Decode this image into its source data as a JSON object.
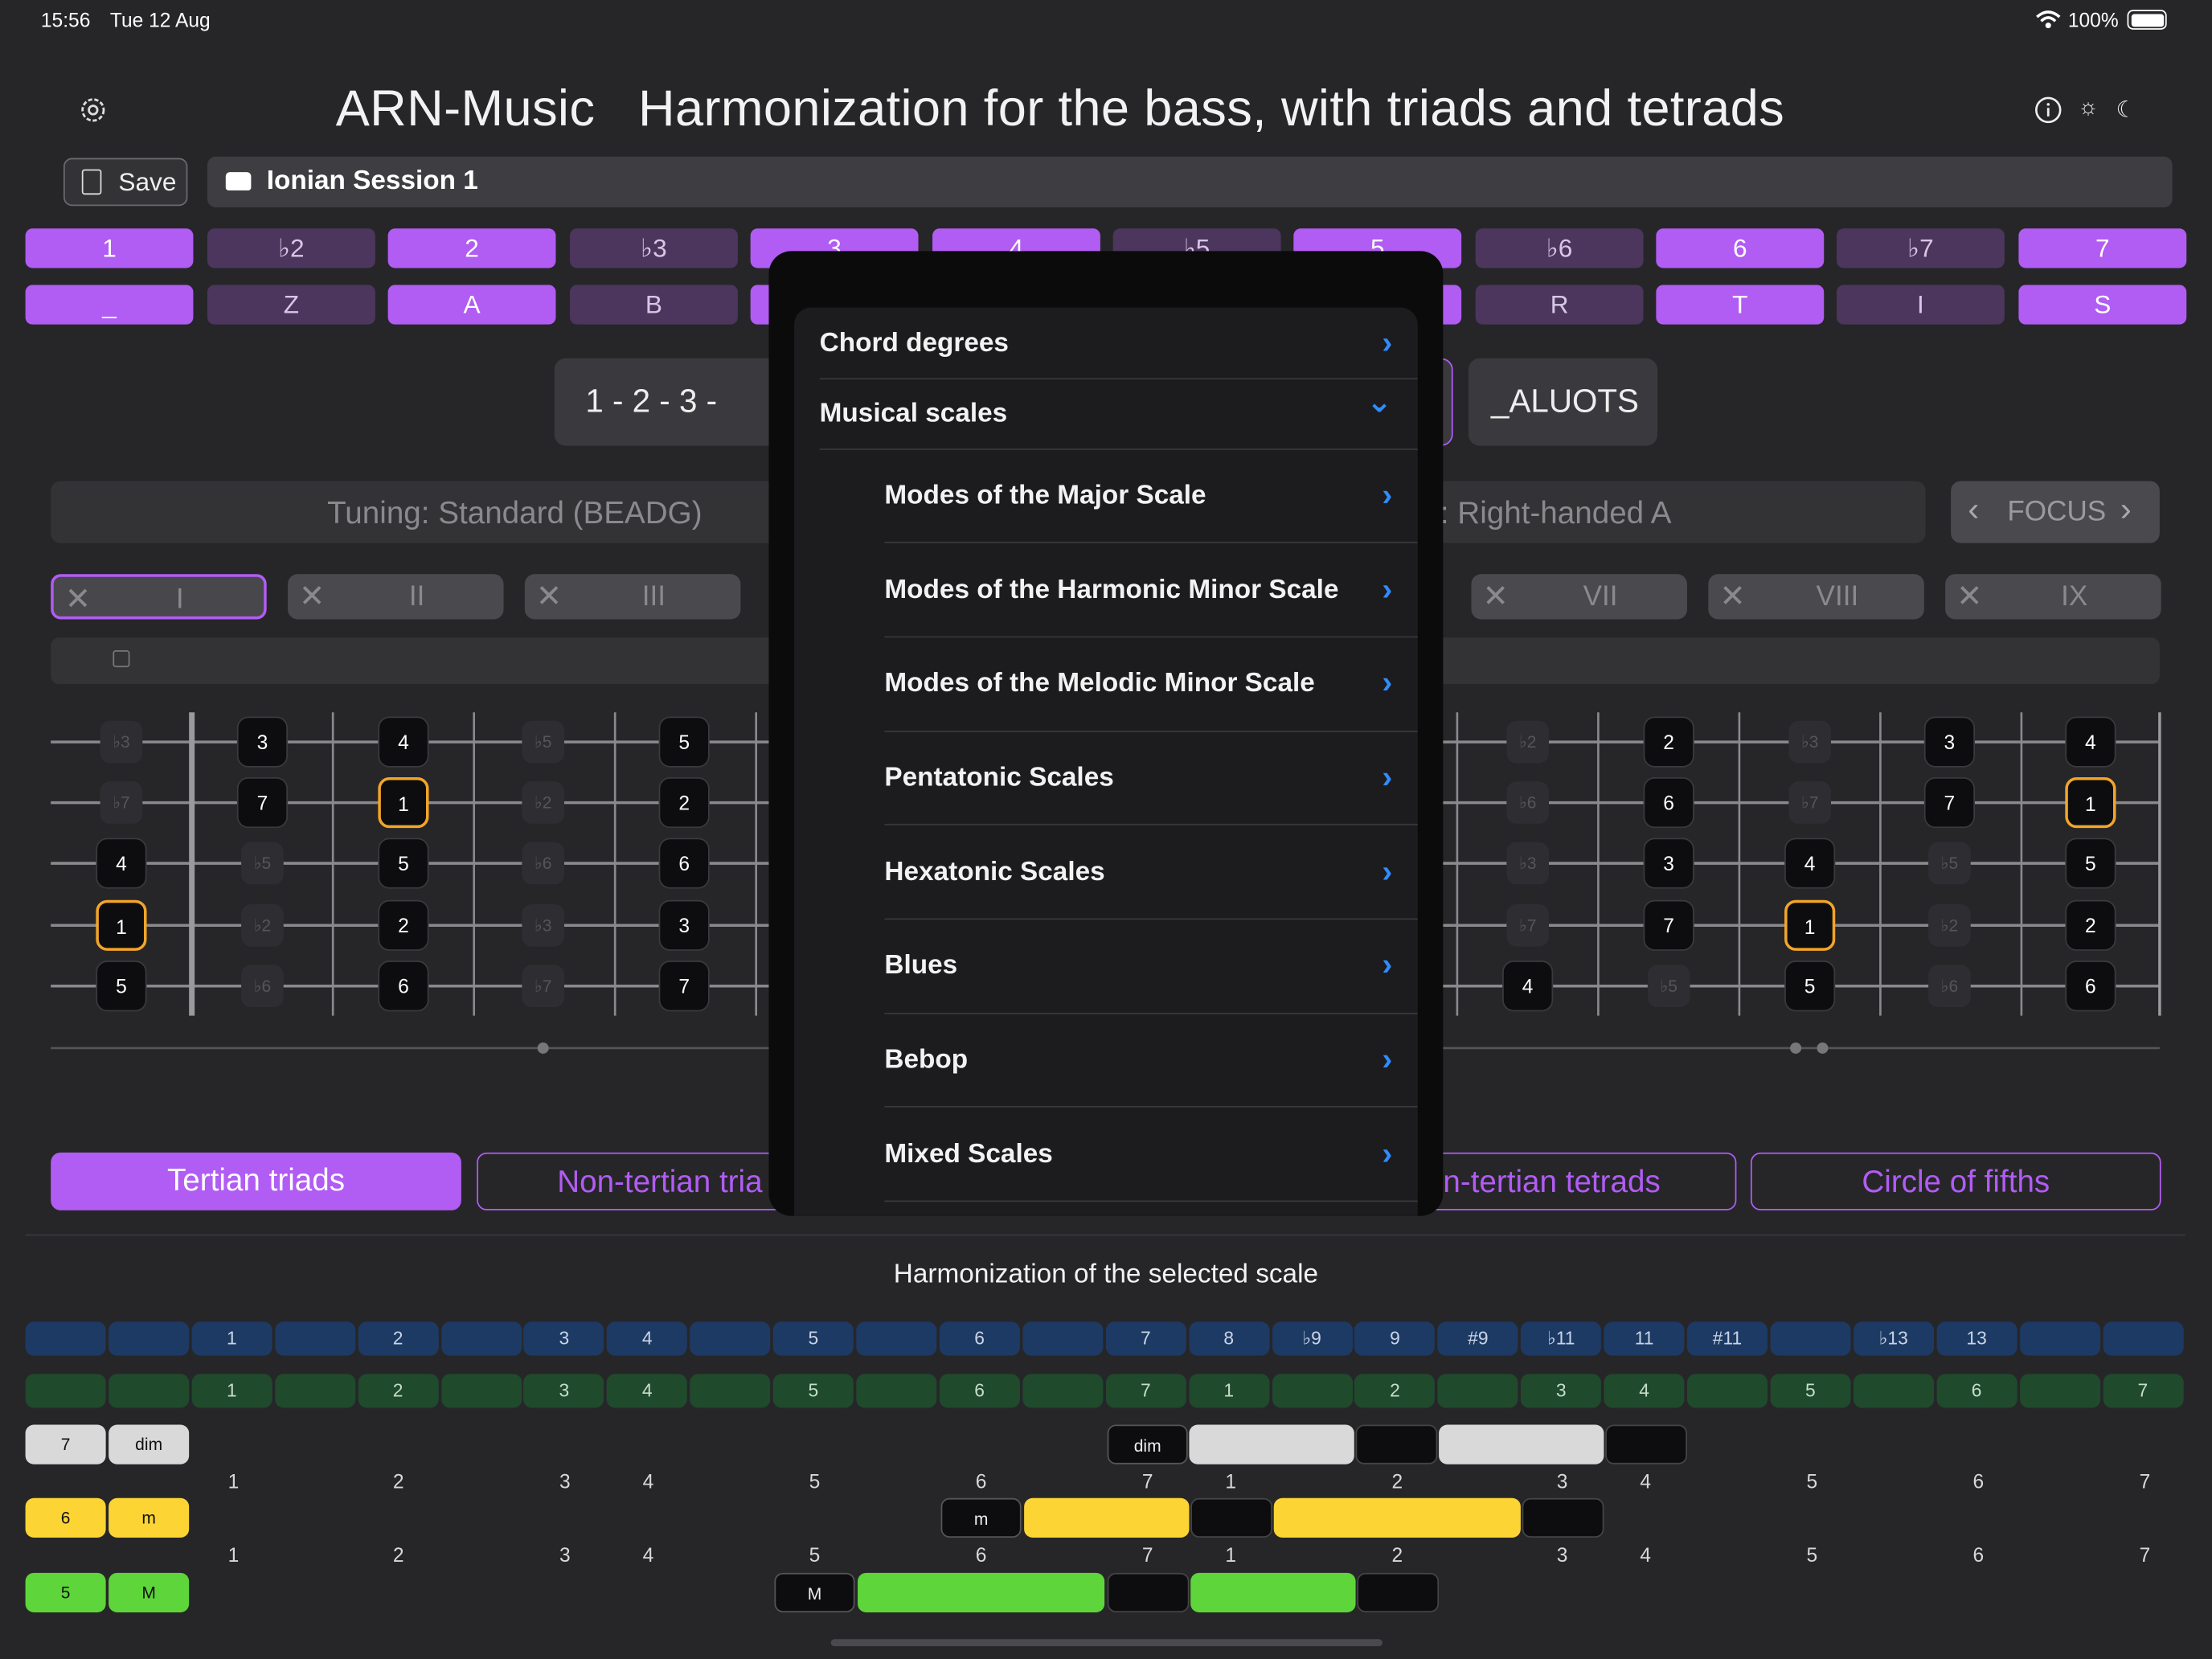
{
  "status": {
    "time": "15:56",
    "date": "Tue 12 Aug",
    "battery": "100%",
    "wifi_icon": "wifi-icon",
    "battery_icon": "battery-icon"
  },
  "header": {
    "app": "ARN-Music",
    "subtitle": "Harmonization for the bass, with triads and tetrads",
    "settings_icon": "gear-icon",
    "info_icon": "info-icon",
    "light_icon": "sun-icon",
    "dark_icon": "moon-icon"
  },
  "toolbar": {
    "save_label": "Save",
    "session_name": "Ionian Session 1"
  },
  "degrees": {
    "top": [
      {
        "l": "1",
        "on": true
      },
      {
        "l": "♭2",
        "on": false
      },
      {
        "l": "2",
        "on": true
      },
      {
        "l": "♭3",
        "on": false
      },
      {
        "l": "3",
        "on": true
      },
      {
        "l": "4",
        "on": true
      },
      {
        "l": "♭5",
        "on": false
      },
      {
        "l": "5",
        "on": true
      },
      {
        "l": "♭6",
        "on": false
      },
      {
        "l": "6",
        "on": true
      },
      {
        "l": "♭7",
        "on": false
      },
      {
        "l": "7",
        "on": true
      }
    ],
    "bottom": [
      {
        "l": "_",
        "on": true
      },
      {
        "l": "Z",
        "on": false
      },
      {
        "l": "A",
        "on": true
      },
      {
        "l": "B",
        "on": false
      },
      {
        "l": "",
        "on": true
      },
      {
        "l": "",
        "on": true
      },
      {
        "l": "",
        "on": false
      },
      {
        "l": "",
        "on": true
      },
      {
        "l": "R",
        "on": false
      },
      {
        "l": "T",
        "on": true
      },
      {
        "l": "I",
        "on": false
      },
      {
        "l": "S",
        "on": true
      }
    ]
  },
  "formula": {
    "degrees_text": "1 - 2 - 3 -",
    "code_text": "_ALUOTS"
  },
  "settings_bar": {
    "tuning": "Tuning: Standard (BEADG)",
    "hand": ": Right-handed A",
    "focus": "FOCUS"
  },
  "positions": [
    "I",
    "II",
    "III",
    "VII",
    "VIII",
    "IX"
  ],
  "tabs": {
    "t1": "Tertian triads",
    "t2": "Non-tertian tria",
    "t3": "n-tertian tetrads",
    "t4": "Circle of fifths"
  },
  "harmonization": {
    "title": "Harmonization of the selected scale",
    "blue_row": [
      "",
      "",
      "1",
      "",
      "2",
      "",
      "3",
      "4",
      "",
      "5",
      "",
      "6",
      "",
      "7",
      "8",
      "♭9",
      "9",
      "#9",
      "♭11",
      "11",
      "#11",
      "",
      "♭13",
      "13",
      "",
      ""
    ],
    "green_row": [
      "",
      "",
      "1",
      "",
      "2",
      "",
      "3",
      "4",
      "",
      "5",
      "",
      "6",
      "",
      "7",
      "1",
      "",
      "2",
      "",
      "3",
      "4",
      "",
      "5",
      "",
      "6",
      "",
      "7"
    ],
    "rows": [
      {
        "deg": "7",
        "q": "dim",
        "chip": "dim"
      },
      {
        "deg": "6",
        "q": "m",
        "chip": "m"
      },
      {
        "deg": "5",
        "q": "M",
        "chip": "M"
      }
    ],
    "lblrow": [
      "1",
      "2",
      "3",
      "4",
      "5",
      "6",
      "7",
      "1",
      "2",
      "3",
      "4",
      "5",
      "6",
      "7"
    ]
  },
  "menu": {
    "items": [
      {
        "label": "Chord degrees"
      },
      {
        "label": "Musical scales"
      },
      {
        "label": "Modes of the Major Scale"
      },
      {
        "label": "Modes of the Harmonic Minor Scale"
      },
      {
        "label": "Modes of the Melodic Minor Scale"
      },
      {
        "label": "Pentatonic Scales"
      },
      {
        "label": "Hexatonic Scales"
      },
      {
        "label": "Blues"
      },
      {
        "label": "Bebop"
      },
      {
        "label": "Mixed Scales"
      }
    ]
  },
  "colors": {
    "accent": "#b15cf3",
    "root": "#f2a529",
    "link": "#2f8cff",
    "dim": "#d9d9d9",
    "minor": "#fcd534",
    "major": "#5ed53a"
  }
}
